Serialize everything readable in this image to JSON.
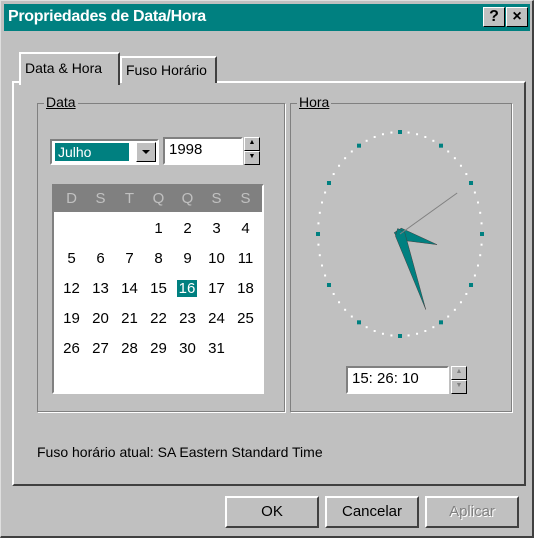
{
  "window": {
    "title": "Propriedades de Data/Hora",
    "help_label": "?",
    "close_label": "×"
  },
  "tabs": [
    {
      "label": "Data & Hora",
      "active": true
    },
    {
      "label": "Fuso Horário",
      "active": false
    }
  ],
  "date_group": {
    "label": "Data",
    "month": "Julho",
    "year": "1998",
    "weekdays": [
      "D",
      "S",
      "T",
      "Q",
      "Q",
      "S",
      "S"
    ],
    "first_weekday_index": 3,
    "days_in_month": 31,
    "selected_day": 16
  },
  "time_group": {
    "label": "Hora",
    "time": "15: 26: 10",
    "hour": 15,
    "minute": 26,
    "second": 10
  },
  "timezone": {
    "text": "Fuso horário atual:  SA Eastern Standard Time"
  },
  "buttons": {
    "ok": "OK",
    "cancel": "Cancelar",
    "apply": "Aplicar"
  },
  "colors": {
    "selection": "#008080",
    "face": "#c0c0c0"
  }
}
